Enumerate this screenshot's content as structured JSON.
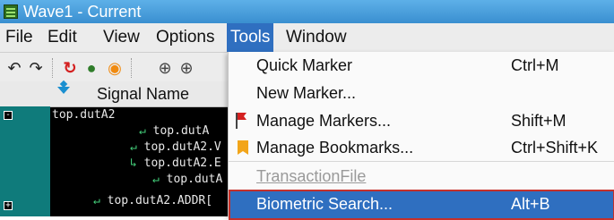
{
  "window": {
    "title": "Wave1 - Current"
  },
  "menubar": {
    "items": [
      {
        "label": "File"
      },
      {
        "label": "Edit"
      },
      {
        "label": "View"
      },
      {
        "label": "Options"
      },
      {
        "label": "Tools",
        "active": true
      },
      {
        "label": "Window"
      }
    ]
  },
  "toolbar": {
    "icons": [
      "undo-icon",
      "redo-icon",
      "reload-icon",
      "color-icon",
      "info-icon",
      "zoom-in-icon",
      "zoom-in-icon"
    ]
  },
  "signal_panel": {
    "header": "Signal Name",
    "rows": [
      {
        "text": "top.dutA2"
      },
      {
        "text": "top.dutA"
      },
      {
        "text": "top.dutA2.V"
      },
      {
        "text": "top.dutA2.E"
      },
      {
        "text": "top.dutA"
      },
      {
        "text": "top.dutA2.ADDR["
      }
    ]
  },
  "tools_menu": {
    "items": [
      {
        "label": "Quick Marker",
        "shortcut": "Ctrl+M"
      },
      {
        "label": "New Marker...",
        "shortcut": ""
      },
      {
        "label": "Manage Markers...",
        "shortcut": "Shift+M",
        "icon": "flag-icon"
      },
      {
        "label": "Manage Bookmarks...",
        "shortcut": "Ctrl+Shift+K",
        "icon": "bookmark-icon"
      },
      {
        "label_first": "T",
        "label_rest": "ransactionFile",
        "disabled": true
      },
      {
        "label": "Biometric Search...",
        "shortcut": "Alt+B",
        "selected": true
      }
    ]
  },
  "colors": {
    "title_bar": "#3a8fd0",
    "menu_active": "#2f6fc0",
    "selection_outline": "#c4302b",
    "signal_bg": "#000000",
    "gutter": "#0f7b7b"
  }
}
